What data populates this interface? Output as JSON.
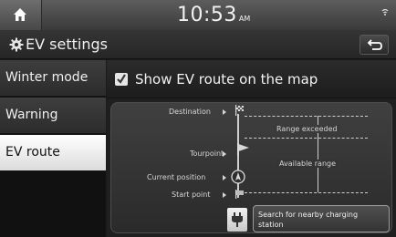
{
  "status": {
    "time": "10:53",
    "ampm": "AM"
  },
  "header": {
    "title": "EV settings"
  },
  "sidebar": {
    "items": [
      {
        "label": "Winter mode",
        "active": false
      },
      {
        "label": "Warning",
        "active": false
      },
      {
        "label": "EV route",
        "active": true
      }
    ]
  },
  "main": {
    "option_label": "Show EV route on the map",
    "option_checked": true,
    "route": {
      "destination": "Destination",
      "tourpoint": "Tourpoint",
      "current_position": "Current position",
      "start_point": "Start point",
      "range_exceeded": "Range exceeded",
      "available_range": "Available range"
    },
    "search_button": "Search for nearby charging station"
  },
  "colors": {
    "active_tab": "#ffffff",
    "accent_text": "#f0f0f0"
  }
}
